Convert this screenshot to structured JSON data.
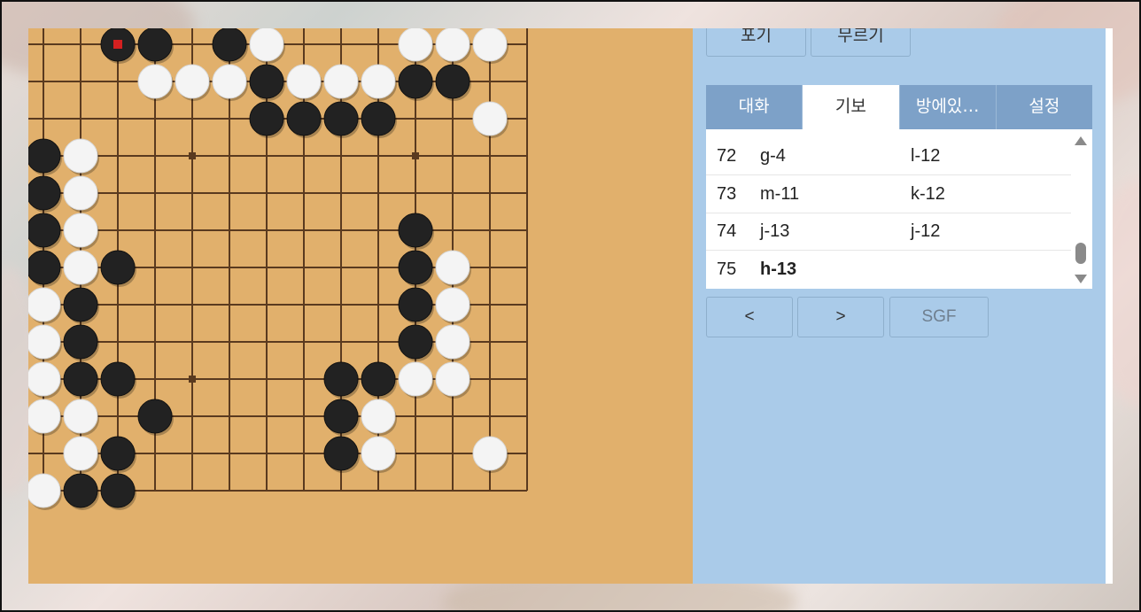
{
  "top_buttons": {
    "resign": "포기",
    "undo": "무르기"
  },
  "tabs": [
    {
      "label": "대화",
      "active": false
    },
    {
      "label": "기보",
      "active": true
    },
    {
      "label": "방에있…",
      "active": false
    },
    {
      "label": "설정",
      "active": false
    }
  ],
  "moves": [
    {
      "num": "72",
      "black": "g-4",
      "white": "l-12"
    },
    {
      "num": "73",
      "black": "m-11",
      "white": "k-12"
    },
    {
      "num": "74",
      "black": "j-13",
      "white": "j-12"
    },
    {
      "num": "75",
      "black": "h-13",
      "white": ""
    }
  ],
  "nav": {
    "prev": "<",
    "next": ">",
    "sgf": "SGF"
  },
  "colors": {
    "board": "#e1b06c",
    "grid_line": "#5a3a1f",
    "panel": "#aacbe9",
    "tab_inactive": "#7da1c8",
    "black_stone": "#222222",
    "white_stone": "#f4f4f4",
    "last_move_marker": "#d42020"
  },
  "board": {
    "visible_columns": 14,
    "visible_rows": 13,
    "star_points": [
      [
        4,
        3
      ],
      [
        10,
        3
      ],
      [
        4,
        9
      ]
    ],
    "last_move": [
      2,
      0
    ],
    "stones": [
      {
        "c": 2,
        "r": 0,
        "color": "B"
      },
      {
        "c": 3,
        "r": 0,
        "color": "B"
      },
      {
        "c": 5,
        "r": 0,
        "color": "B"
      },
      {
        "c": 6,
        "r": 0,
        "color": "W"
      },
      {
        "c": 10,
        "r": 0,
        "color": "W"
      },
      {
        "c": 11,
        "r": 0,
        "color": "W"
      },
      {
        "c": 12,
        "r": 0,
        "color": "W"
      },
      {
        "c": 3,
        "r": 1,
        "color": "W"
      },
      {
        "c": 4,
        "r": 1,
        "color": "W"
      },
      {
        "c": 5,
        "r": 1,
        "color": "W"
      },
      {
        "c": 6,
        "r": 1,
        "color": "B"
      },
      {
        "c": 7,
        "r": 1,
        "color": "W"
      },
      {
        "c": 8,
        "r": 1,
        "color": "W"
      },
      {
        "c": 9,
        "r": 1,
        "color": "W"
      },
      {
        "c": 10,
        "r": 1,
        "color": "B"
      },
      {
        "c": 11,
        "r": 1,
        "color": "B"
      },
      {
        "c": 6,
        "r": 2,
        "color": "B"
      },
      {
        "c": 7,
        "r": 2,
        "color": "B"
      },
      {
        "c": 8,
        "r": 2,
        "color": "B"
      },
      {
        "c": 9,
        "r": 2,
        "color": "B"
      },
      {
        "c": 12,
        "r": 2,
        "color": "W"
      },
      {
        "c": 0,
        "r": 3,
        "color": "B"
      },
      {
        "c": 1,
        "r": 3,
        "color": "W"
      },
      {
        "c": 0,
        "r": 4,
        "color": "B"
      },
      {
        "c": 1,
        "r": 4,
        "color": "W"
      },
      {
        "c": 0,
        "r": 5,
        "color": "B"
      },
      {
        "c": 1,
        "r": 5,
        "color": "W"
      },
      {
        "c": 10,
        "r": 5,
        "color": "B"
      },
      {
        "c": 0,
        "r": 6,
        "color": "B"
      },
      {
        "c": 1,
        "r": 6,
        "color": "W"
      },
      {
        "c": 2,
        "r": 6,
        "color": "B"
      },
      {
        "c": 10,
        "r": 6,
        "color": "B"
      },
      {
        "c": 11,
        "r": 6,
        "color": "W"
      },
      {
        "c": 0,
        "r": 7,
        "color": "W"
      },
      {
        "c": 1,
        "r": 7,
        "color": "B"
      },
      {
        "c": 10,
        "r": 7,
        "color": "B"
      },
      {
        "c": 11,
        "r": 7,
        "color": "W"
      },
      {
        "c": 0,
        "r": 8,
        "color": "W"
      },
      {
        "c": 1,
        "r": 8,
        "color": "B"
      },
      {
        "c": 10,
        "r": 8,
        "color": "B"
      },
      {
        "c": 11,
        "r": 8,
        "color": "W"
      },
      {
        "c": 0,
        "r": 9,
        "color": "W"
      },
      {
        "c": 1,
        "r": 9,
        "color": "B"
      },
      {
        "c": 2,
        "r": 9,
        "color": "B"
      },
      {
        "c": 8,
        "r": 9,
        "color": "B"
      },
      {
        "c": 9,
        "r": 9,
        "color": "B"
      },
      {
        "c": 10,
        "r": 9,
        "color": "W"
      },
      {
        "c": 11,
        "r": 9,
        "color": "W"
      },
      {
        "c": 0,
        "r": 10,
        "color": "W"
      },
      {
        "c": 1,
        "r": 10,
        "color": "W"
      },
      {
        "c": 3,
        "r": 10,
        "color": "B"
      },
      {
        "c": 8,
        "r": 10,
        "color": "B"
      },
      {
        "c": 9,
        "r": 10,
        "color": "W"
      },
      {
        "c": 1,
        "r": 11,
        "color": "W"
      },
      {
        "c": 2,
        "r": 11,
        "color": "B"
      },
      {
        "c": 8,
        "r": 11,
        "color": "B"
      },
      {
        "c": 9,
        "r": 11,
        "color": "W"
      },
      {
        "c": 12,
        "r": 11,
        "color": "W"
      },
      {
        "c": 0,
        "r": 12,
        "color": "W"
      },
      {
        "c": 1,
        "r": 12,
        "color": "B"
      },
      {
        "c": 2,
        "r": 12,
        "color": "B"
      }
    ]
  }
}
